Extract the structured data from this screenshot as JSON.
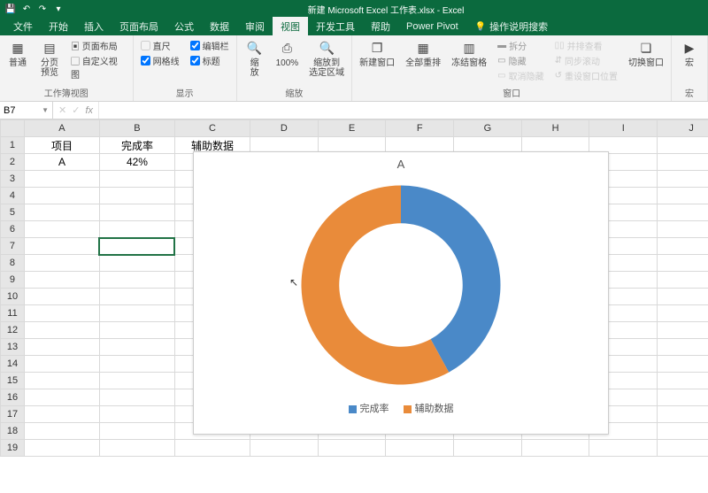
{
  "titlebar": {
    "title": "新建 Microsoft Excel 工作表.xlsx - Excel"
  },
  "tabs": {
    "items": [
      "文件",
      "开始",
      "插入",
      "页面布局",
      "公式",
      "数据",
      "审阅",
      "视图",
      "开发工具",
      "帮助",
      "Power Pivot"
    ],
    "active_index": 7,
    "tellme": "操作说明搜索"
  },
  "ribbon": {
    "group1": {
      "label": "工作簿视图",
      "btn_normal": "普通",
      "btn_pagebreak": "分页\n预览",
      "btn_pagelayout": "页面布局",
      "btn_custom": "自定义视图"
    },
    "group2": {
      "label": "显示",
      "chk_ruler": "直尺",
      "chk_formula": "编辑栏",
      "chk_grid": "网格线",
      "chk_headings": "标题"
    },
    "group3": {
      "label": "缩放",
      "btn_zoom": "缩\n放",
      "btn_100": "100%",
      "btn_zoomsel": "缩放到\n选定区域"
    },
    "group4": {
      "label": "窗口",
      "btn_new": "新建窗口",
      "btn_arrange": "全部重排",
      "btn_freeze": "冻结窗格",
      "row_split": "拆分",
      "row_hide": "隐藏",
      "row_unhide": "取消隐藏",
      "row_side1": "并排查看",
      "row_side2": "同步滚动",
      "row_side3": "重设窗口位置",
      "btn_switch": "切换窗口"
    },
    "group5": {
      "btn_macro": "宏",
      "label": "宏"
    }
  },
  "namebox": {
    "ref": "B7"
  },
  "formulabar": {
    "fx_label": "fx"
  },
  "columns": [
    "A",
    "B",
    "C",
    "D",
    "E",
    "F",
    "G",
    "H",
    "I",
    "J"
  ],
  "rows": [
    "1",
    "2",
    "3",
    "4",
    "5",
    "6",
    "7",
    "8",
    "9",
    "10",
    "11",
    "12",
    "13",
    "14",
    "15",
    "16",
    "17",
    "18",
    "19"
  ],
  "cells": {
    "A1": "项目",
    "B1": "完成率",
    "C1": "辅助数据",
    "A2": "A",
    "B2": "42%",
    "C2": "58%"
  },
  "active_cell": "B7",
  "chart_data": {
    "type": "pie",
    "title": "A",
    "series": [
      {
        "name": "完成率",
        "values": [
          42
        ],
        "color": "#4a89c8"
      },
      {
        "name": "辅助数据",
        "values": [
          58
        ],
        "color": "#e98b3a"
      }
    ],
    "donut_hole": 0.62,
    "start_angle": 90
  },
  "legend": {
    "item1": "完成率",
    "item2": "辅助数据",
    "color1": "#4a89c8",
    "color2": "#e98b3a"
  }
}
